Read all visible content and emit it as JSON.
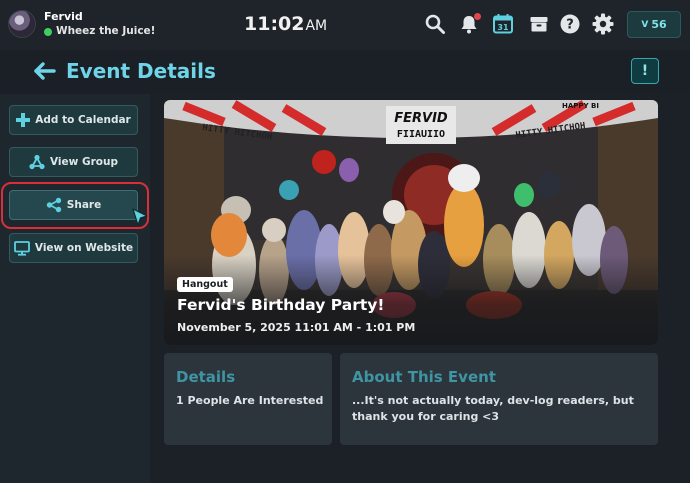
{
  "profile": {
    "username": "Fervid",
    "status": "Wheez the Juice!"
  },
  "clock": {
    "time": "11:02",
    "ampm": "AM"
  },
  "topbar": {
    "icons": [
      "search-icon",
      "notifications-bell-icon",
      "calendar-icon",
      "inventory-icon",
      "help-icon",
      "settings-icon"
    ],
    "calendar_day": "31",
    "credits": "56",
    "credits_glyph": "V"
  },
  "header": {
    "title": "Event Details",
    "report_glyph": "!"
  },
  "sidebar": {
    "items": [
      {
        "label": "Add to Calendar",
        "icon": "plus-icon"
      },
      {
        "label": "View Group",
        "icon": "group-icon"
      },
      {
        "label": "Share",
        "icon": "share-icon"
      },
      {
        "label": "View on Website",
        "icon": "monitor-icon"
      }
    ]
  },
  "event": {
    "tag": "Hangout",
    "title": "Fervid's Birthday Party!",
    "date": "November 5, 2025 11:01 AM - 1:01 PM",
    "banner_text": "FERVID",
    "banner_text_mirror": "FIIAUIIO",
    "banner_ribbon_left": "HITTY HITCHOH",
    "banner_ribbon_right": "HITTY HITCHOH",
    "banner_ribbon_corner": "HAPPY BI"
  },
  "details": {
    "title": "Details",
    "body": "1 People Are Interested"
  },
  "about": {
    "title": "About This Event",
    "body": "...It's not actually today, dev-log readers, but thank you for caring <3"
  },
  "colors": {
    "accent": "#6fd4e8",
    "button_bg": "#1f3a3f",
    "highlight_ring": "#d92f3b",
    "online": "#3ecf62"
  }
}
